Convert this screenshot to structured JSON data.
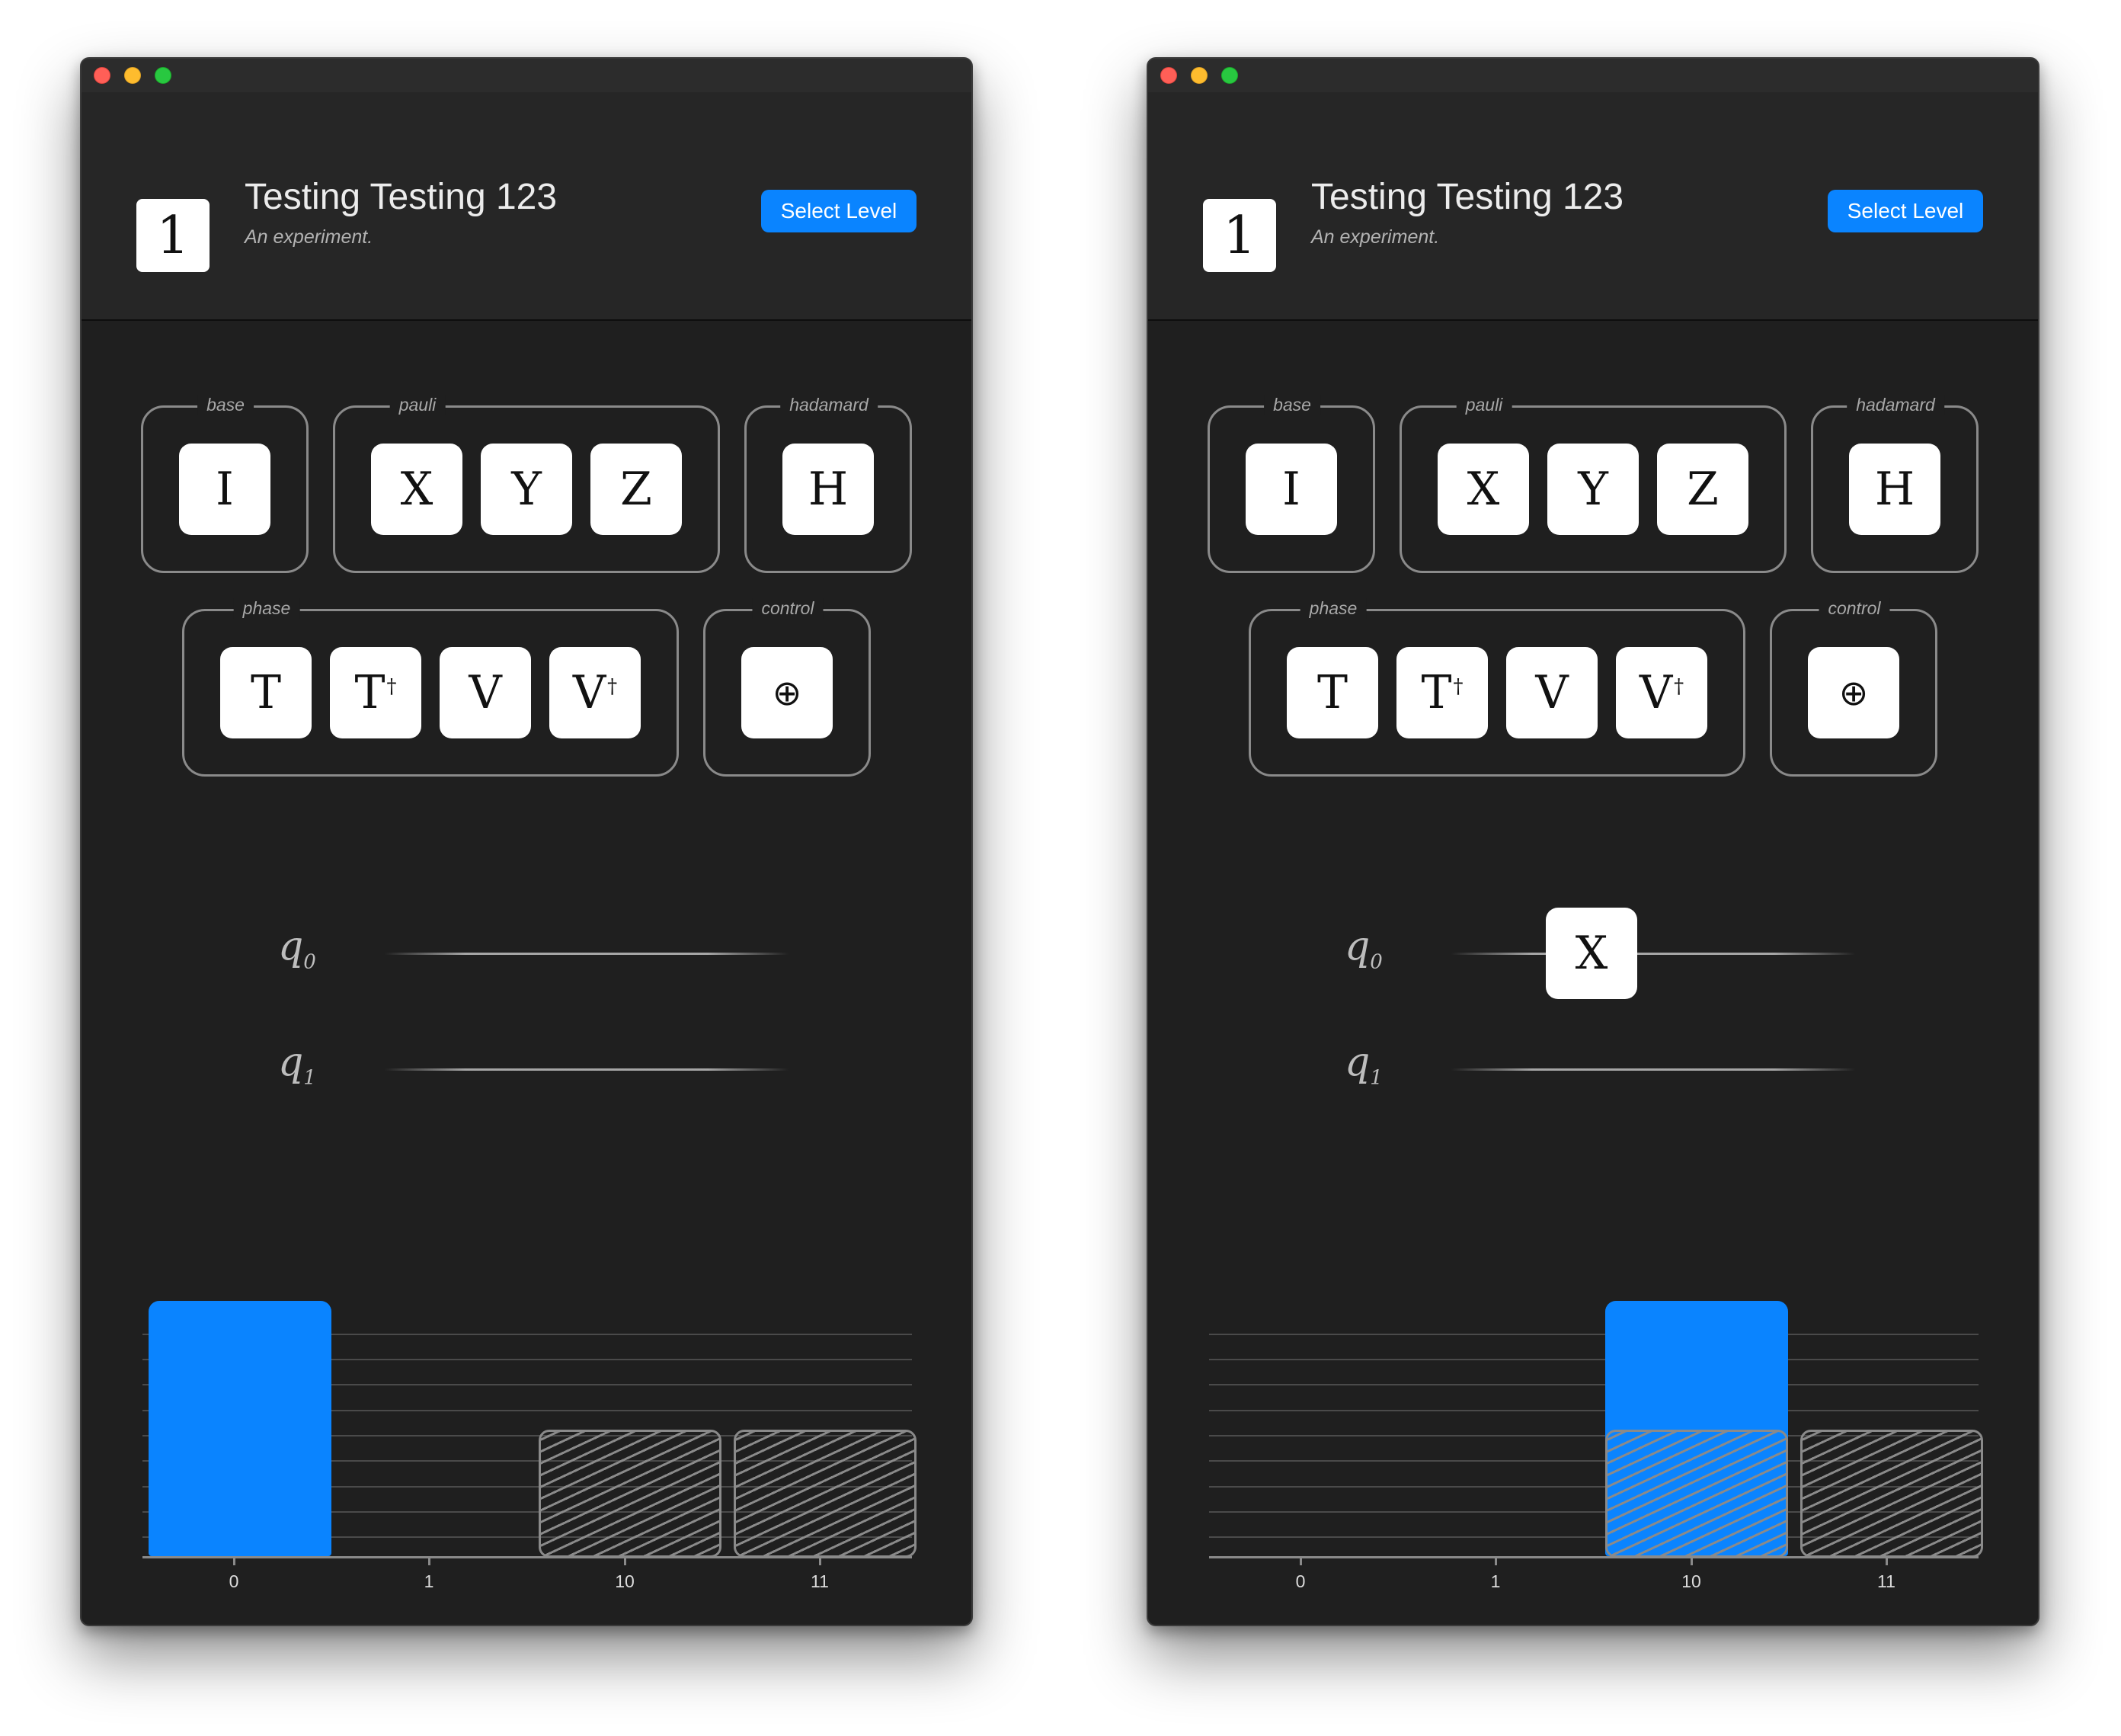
{
  "windows": [
    {
      "level_number": "1",
      "title": "Testing Testing 123",
      "subtitle": "An experiment.",
      "select_level_label": "Select Level",
      "groups": {
        "base": {
          "label": "base",
          "gates": [
            "I"
          ]
        },
        "pauli": {
          "label": "pauli",
          "gates": [
            "X",
            "Y",
            "Z"
          ]
        },
        "hadamard": {
          "label": "hadamard",
          "gates": [
            "H"
          ]
        },
        "phase": {
          "label": "phase",
          "gates": [
            "T",
            "T",
            "V",
            "V"
          ],
          "dagger": "†"
        },
        "control": {
          "label": "control",
          "gates": [
            "⊕"
          ]
        }
      },
      "qubits": [
        {
          "name": "q",
          "index": "0",
          "placed_gates": []
        },
        {
          "name": "q",
          "index": "1",
          "placed_gates": []
        }
      ],
      "histogram": {
        "states": [
          "0",
          "1",
          "10",
          "11"
        ],
        "probabilities": [
          1.0,
          0.0,
          0.0,
          0.0
        ],
        "targets": [
          0.0,
          0.0,
          0.5,
          0.5
        ],
        "bar_color": "#0a84ff"
      }
    },
    {
      "level_number": "1",
      "title": "Testing Testing 123",
      "subtitle": "An experiment.",
      "select_level_label": "Select Level",
      "groups": {
        "base": {
          "label": "base",
          "gates": [
            "I"
          ]
        },
        "pauli": {
          "label": "pauli",
          "gates": [
            "X",
            "Y",
            "Z"
          ]
        },
        "hadamard": {
          "label": "hadamard",
          "gates": [
            "H"
          ]
        },
        "phase": {
          "label": "phase",
          "gates": [
            "T",
            "T",
            "V",
            "V"
          ],
          "dagger": "†"
        },
        "control": {
          "label": "control",
          "gates": [
            "⊕"
          ]
        }
      },
      "qubits": [
        {
          "name": "q",
          "index": "0",
          "placed_gates": [
            "X"
          ]
        },
        {
          "name": "q",
          "index": "1",
          "placed_gates": []
        }
      ],
      "histogram": {
        "states": [
          "0",
          "1",
          "10",
          "11"
        ],
        "probabilities": [
          0.0,
          0.0,
          1.0,
          0.0
        ],
        "targets": [
          0.0,
          0.0,
          0.5,
          0.5
        ],
        "bar_color": "#0a84ff"
      }
    }
  ]
}
